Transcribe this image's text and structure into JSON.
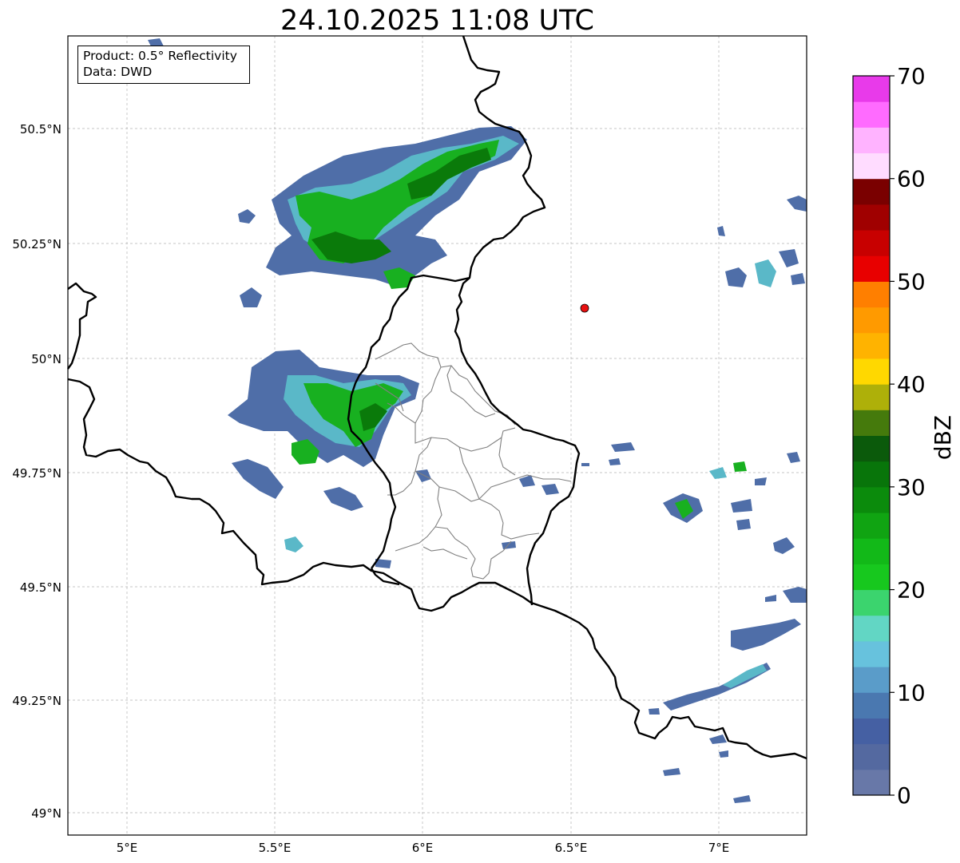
{
  "title": "24.10.2025 11:08 UTC",
  "info": {
    "product": "Product: 0.5° Reflectivity",
    "data": "Data: DWD"
  },
  "axes": {
    "lat_ticks": [
      "50.5°N",
      "50.25°N",
      "50°N",
      "49.75°N",
      "49.5°N",
      "49.25°N",
      "49°N"
    ],
    "lon_ticks": [
      "5°E",
      "5.5°E",
      "6°E",
      "6.5°E",
      "7°E"
    ]
  },
  "colorbar": {
    "label": "dBZ",
    "tick_labels": [
      "0",
      "10",
      "20",
      "30",
      "40",
      "50",
      "60",
      "70"
    ],
    "colors": [
      "#6878a8",
      "#5469a0",
      "#4560a3",
      "#4a78b0",
      "#5a9cc9",
      "#67c2dd",
      "#62d6c4",
      "#3bd46e",
      "#17c81e",
      "#12b918",
      "#10a412",
      "#0b8b0c",
      "#08750a",
      "#0b5a0b",
      "#457a0c",
      "#aeb009",
      "#ffd800",
      "#ffb300",
      "#ff9a00",
      "#ff7f00",
      "#e80000",
      "#c80000",
      "#a00000",
      "#7a0000",
      "#ffdcff",
      "#ffb3ff",
      "#ff6bff",
      "#e83aea"
    ]
  },
  "station_marker": {
    "color": "#e81010"
  },
  "map_colors": {
    "border": "#000000",
    "district": "#808080",
    "grid": "#b4b4b4",
    "weak_echo": "#4f6ea8",
    "mid_echo": "#5ab8c8",
    "strong_echo": "#18b020",
    "core_echo": "#0a7a0a"
  }
}
